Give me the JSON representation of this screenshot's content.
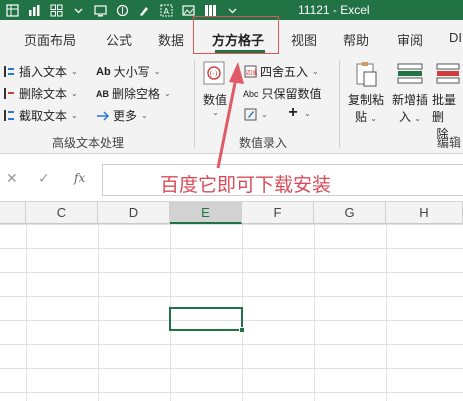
{
  "window": {
    "title": "11121  -  Excel"
  },
  "tabs": [
    {
      "label": "页面布局"
    },
    {
      "label": "公式"
    },
    {
      "label": "数据"
    },
    {
      "label": "方方格子",
      "active": true
    },
    {
      "label": "视图"
    },
    {
      "label": "帮助"
    },
    {
      "label": "审阅"
    },
    {
      "label": "DI"
    }
  ],
  "ribbon": {
    "text_group": {
      "insert_text": "插入文本",
      "delete_text": "删除文本",
      "cut_text": "截取文本",
      "case_icon_text": "Ab",
      "case": "大小写",
      "remove_space_icon_text": "AB",
      "remove_space": "删除空格",
      "more": "更多",
      "label": "高级文本处理"
    },
    "number_group": {
      "numeric": "数值",
      "round_icon_text": "四舍五",
      "round": "四舍五入",
      "keep_icon_text": "Abc",
      "keep_values": "只保留数值",
      "label": "数值录入"
    },
    "edit_group": {
      "copy_paste_line1": "复制粘",
      "copy_paste_line2": "贴",
      "insert_new_line1": "新增插",
      "insert_new_line2": "入",
      "batch_delete_line1": "批量删",
      "batch_delete_line2": "除",
      "label": "编辑"
    }
  },
  "formula_bar": {
    "fx": "fx",
    "value": ""
  },
  "annotation": {
    "text": "百度它即可下载安装"
  },
  "columns": [
    "C",
    "D",
    "E",
    "F",
    "G",
    "H"
  ],
  "selected_column": "E",
  "colors": {
    "accent": "#217346",
    "annotation": "#d94b5a"
  }
}
